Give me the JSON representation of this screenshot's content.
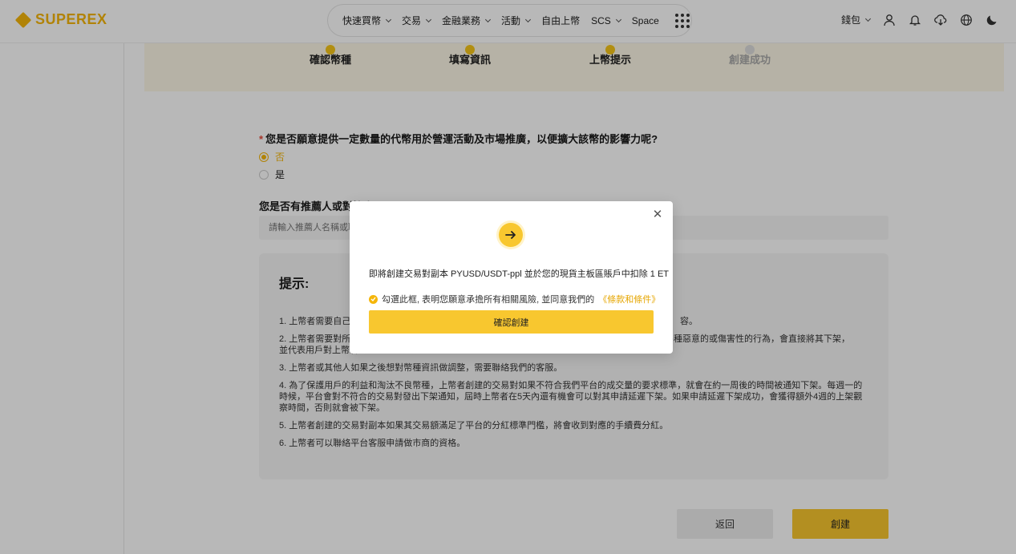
{
  "header": {
    "logo_text": "SUPEREX",
    "nav": [
      {
        "label": "快速買幣",
        "has_dropdown": true
      },
      {
        "label": "交易",
        "has_dropdown": true
      },
      {
        "label": "金融業務",
        "has_dropdown": true
      },
      {
        "label": "活動",
        "has_dropdown": true
      },
      {
        "label": "自由上幣",
        "has_dropdown": false
      },
      {
        "label": "SCS",
        "has_dropdown": true
      },
      {
        "label": "Space",
        "has_dropdown": false
      }
    ],
    "wallet_label": "錢包",
    "icons": [
      "user-icon",
      "bell-icon",
      "download-icon",
      "globe-icon",
      "moon-icon"
    ]
  },
  "steps": [
    {
      "label": "確認幣種",
      "active": true
    },
    {
      "label": "填寫資訊",
      "active": true
    },
    {
      "label": "上幣提示",
      "active": true
    },
    {
      "label": "創建成功",
      "active": false
    }
  ],
  "form": {
    "question_required_mark": "*",
    "question": "您是否願意提供一定數量的代幣用於營運活動及市場推廣，以便擴大該幣的影響力呢?",
    "options": [
      {
        "label": "否",
        "selected": true
      },
      {
        "label": "是",
        "selected": false
      }
    ],
    "referrer_label": "您是否有推薦人或對接人?",
    "referrer_placeholder": "請輸入推薦人名稱或聯"
  },
  "tips": {
    "title": "提示:",
    "items": [
      "1. 上幣者需要自己對",
      "2. 上幣者需要對所",
      "有各種惡意的或傷害性的行為，會直接將其下架，",
      "並代表用戶對上幣者",
      "3. 上幣者或其他人如果之後想對幣種資訊做調整，需要聯絡我們的客服。",
      "4. 為了保護用戶的利益和淘汰不良幣種，上幣者創建的交易對如果不符合我們平台的成交量的要求標準，就會在約一周後的時間被通知下架。每週一的時候，平台會對不符合的交易對發出下架通知，屆時上幣者在5天內還有機會可以對其申請延遲下架。如果申請延遲下架成功，會獲得額外4週的上架觀察時間，否則就會被下架。",
      "5. 上幣者創建的交易對副本如果其交易額滿足了平台的分紅標準門檻，將會收到對應的手續費分紅。",
      "6. 上幣者可以聯絡平台客服申請做市商的資格。"
    ],
    "tail_1": "容。"
  },
  "buttons": {
    "back": "返回",
    "create": "創建"
  },
  "modal": {
    "message": "即將創建交易對副本 PYUSD/USDT-ppl 並於您的現貨主板區賬戶中扣除 1 ET",
    "agree_text": "勾選此框, 表明您願意承擔所有相關風險, 並同意我們的",
    "terms_link": "《條款和條件》",
    "agree_checked": true,
    "confirm": "確認創建"
  },
  "colors": {
    "brand": "#f5b60a",
    "button": "#f8c72f",
    "steps_bg": "#fdf7e6"
  }
}
